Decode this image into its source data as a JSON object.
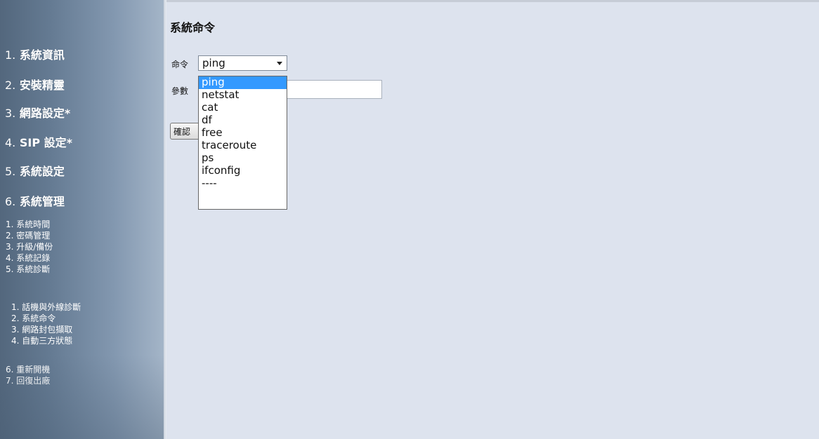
{
  "page": {
    "title": "系統命令",
    "command_label": "命令",
    "param_label": "參數",
    "confirm_label": "確認",
    "param_value": ""
  },
  "sidebar": {
    "main": [
      {
        "num": "1.",
        "label": "系統資訊"
      },
      {
        "num": "2.",
        "label": "安裝精靈"
      },
      {
        "num": "3.",
        "label": "網路設定*"
      },
      {
        "num": "4.",
        "label": "SIP 設定*"
      },
      {
        "num": "5.",
        "label": "系統設定"
      },
      {
        "num": "6.",
        "label": "系統管理"
      }
    ],
    "sub": [
      "1. 系統時間",
      "2. 密碼管理",
      "3. 升級/備份",
      "4. 系統記錄",
      "5. 系統診斷"
    ],
    "sub2": [
      "1. 話機與外線診斷",
      "2. 系統命令",
      "3. 網路封包擷取",
      "4. 自動三方狀態"
    ],
    "sub3": [
      "6. 重新開機",
      "7. 回復出廠"
    ]
  },
  "command_select": {
    "value": "ping",
    "options": [
      "ping",
      "netstat",
      "cat",
      "df",
      "free",
      "traceroute",
      "ps",
      "ifconfig",
      "----"
    ]
  },
  "colors": {
    "content_bg": "#dde3ee",
    "highlight": "#3399ff"
  }
}
